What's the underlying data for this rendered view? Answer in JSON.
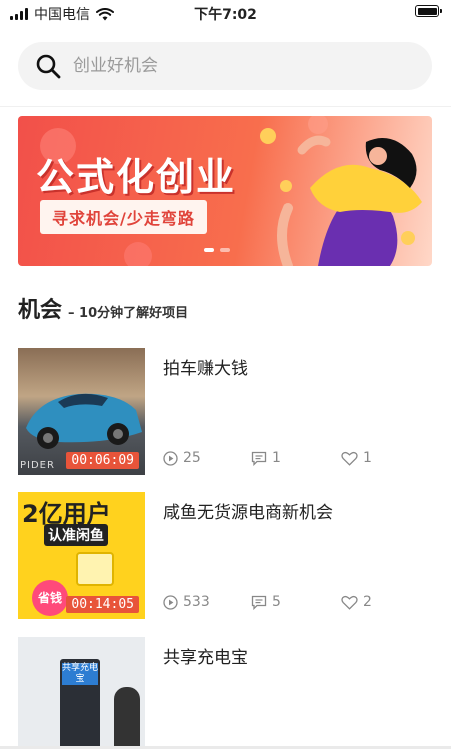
{
  "status_bar": {
    "carrier": "中国电信",
    "time": "下午7:02"
  },
  "search": {
    "placeholder": "创业好机会"
  },
  "banner": {
    "title": "公式化创业",
    "subtitle": "寻求机会/少走弯路",
    "slide_count": 2,
    "active_slide": 0
  },
  "section": {
    "title": "机会",
    "subtitle": "– 10分钟了解好项目"
  },
  "items": [
    {
      "title": "拍车赚大钱",
      "duration": "00:06:09",
      "views": "25",
      "comments": "1",
      "likes": "1",
      "thumb_text": "PIDER"
    },
    {
      "title": "咸鱼无货源电商新机会",
      "duration": "00:14:05",
      "views": "533",
      "comments": "5",
      "likes": "2",
      "thumb_text": "2亿用户",
      "thumb_text2": "认准闲鱼",
      "thumb_badge": "省钱"
    },
    {
      "title": "共享充电宝",
      "thumb_text": "共享充电宝"
    }
  ],
  "colors": {
    "accent": "#e8543a",
    "banner_red": "#f2504a",
    "muted": "#888888"
  }
}
